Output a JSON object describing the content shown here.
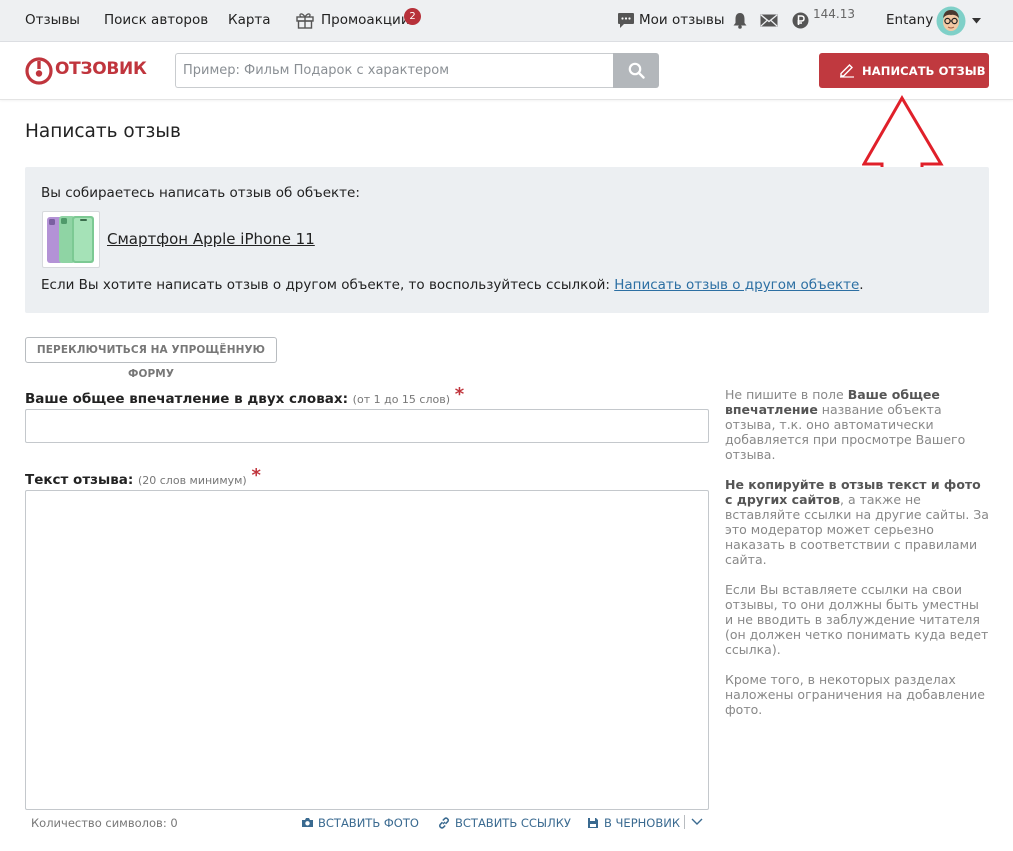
{
  "topnav": {
    "reviews": "Отзывы",
    "author_search": "Поиск авторов",
    "map": "Карта",
    "promos": "Промоакции",
    "promos_badge": "2",
    "my_reviews": "Мои отзывы",
    "balance": "144.13",
    "username": "Entany"
  },
  "header": {
    "logo_text": "ОТЗОВИК",
    "search_placeholder": "Пример: Фильм Подарок с характером",
    "write_button": "НАПИСАТЬ ОТЗЫВ"
  },
  "main": {
    "title": "Написать отзыв",
    "object_intro": "Вы собираетесь написать отзыв об объекте:",
    "object_name": "Смартфон Apple iPhone 11",
    "other_prefix": "Если Вы хотите написать отзыв о другом объекте, то воспользуйтесь ссылкой: ",
    "other_link": "Написать отзыв о другом объекте",
    "other_suffix": ".",
    "switch_button": "ПЕРЕКЛЮЧИТЬСЯ НА УПРОЩЁННУЮ ФОРМУ",
    "impression_label": "Ваше общее впечатление в двух словах:",
    "impression_hint": "(от 1 до 15 слов)",
    "text_label": "Текст отзыва:",
    "text_hint": "(20 слов минимум)",
    "required_mark": "*",
    "impression_value": "",
    "text_value": "",
    "char_count": "Количество символов: 0",
    "insert_photo": "ВСТАВИТЬ ФОТО",
    "insert_link": "ВСТАВИТЬ ССЫЛКУ",
    "to_draft": "В ЧЕРНОВИК"
  },
  "sidebar": {
    "p1_pre": "Не пишите в поле ",
    "p1_bold": "Ваше общее впечатление",
    "p1_post": " название объекта отзыва, т.к. оно автоматически добавляется при просмотре Вашего отзыва.",
    "p2_bold": "Не копируйте в отзыв текст и фото с других сайтов",
    "p2_post": ", а также не вставляйте ссылки на другие сайты. За это модератор может серьезно наказать в соответствии с правилами сайта.",
    "p3": "Если Вы вставляете ссылки на свои отзывы, то они должны быть уместны и не вводить в заблуждение читателя (он должен четко понимать куда ведет ссылка).",
    "p4": "Кроме того, в некоторых разделах наложены ограничения на добавление фото."
  },
  "colors": {
    "brand_red": "#c0393f",
    "link_blue": "#2c6fa3",
    "annotation_red": "#e0202a"
  }
}
